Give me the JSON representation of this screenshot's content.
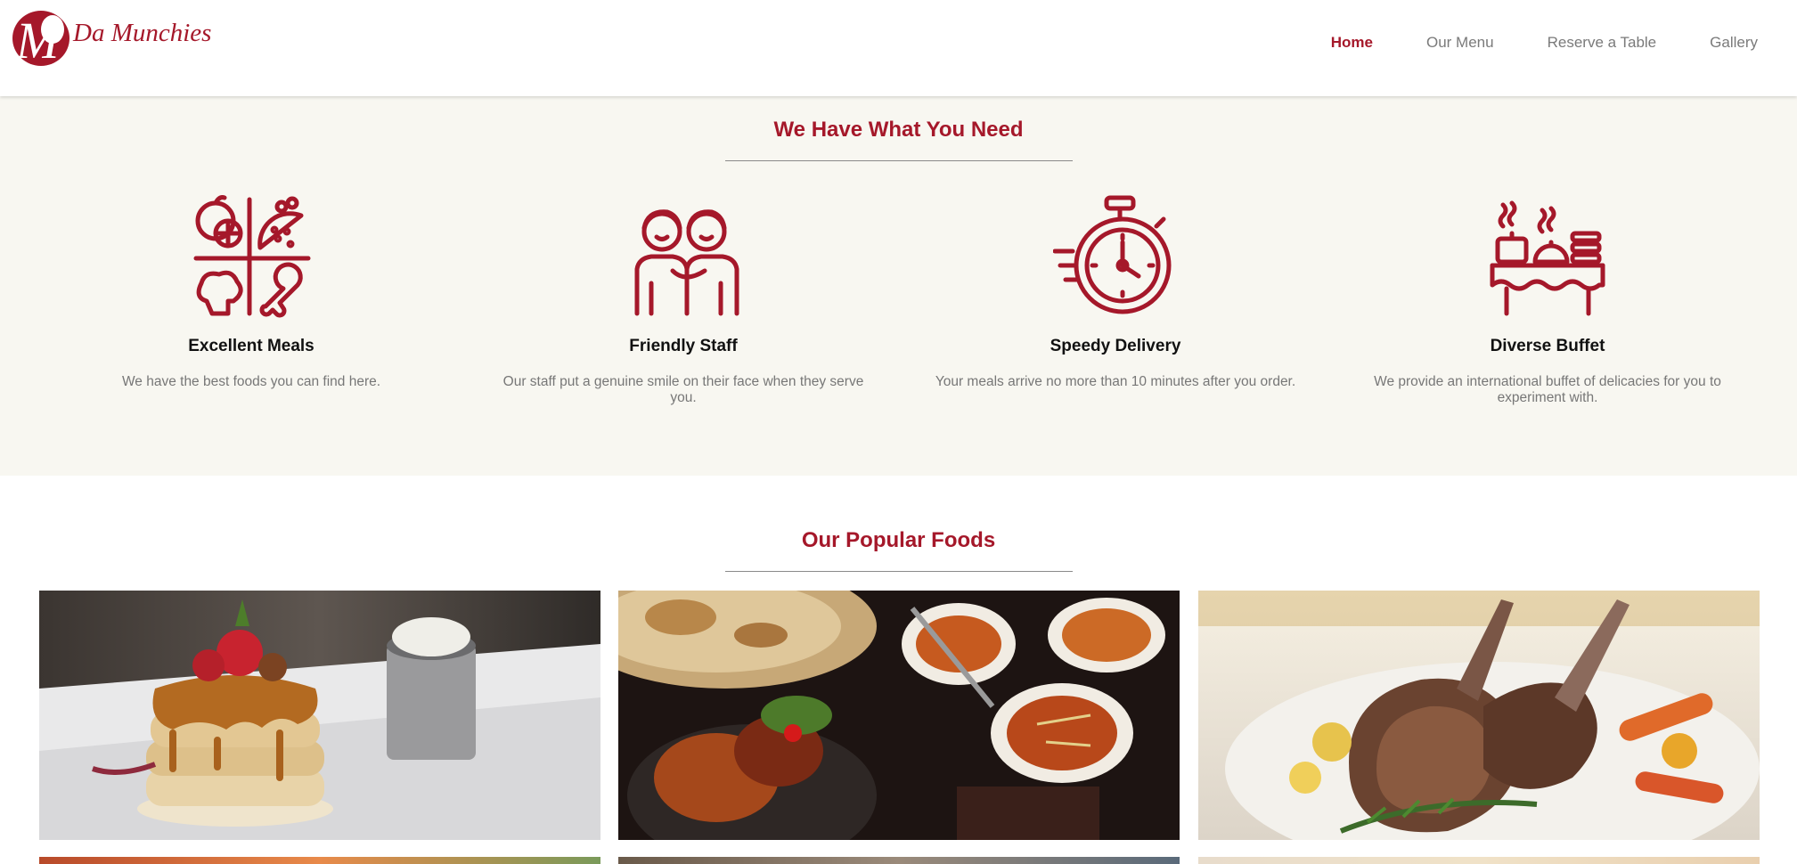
{
  "brand": {
    "logo_letter": "M",
    "name": "Da Munchies",
    "accent": "#a5182a"
  },
  "nav": {
    "items": [
      {
        "label": "Home",
        "active": true
      },
      {
        "label": "Our Menu",
        "active": false
      },
      {
        "label": "Reserve a Table",
        "active": false
      },
      {
        "label": "Gallery",
        "active": false
      }
    ]
  },
  "features": {
    "title": "We Have What You Need",
    "items": [
      {
        "icon": "meals-icon",
        "title": "Excellent Meals",
        "text": "We have the best foods you can find here."
      },
      {
        "icon": "staff-icon",
        "title": "Friendly Staff",
        "text": "Our staff put a genuine smile on their face when they serve you."
      },
      {
        "icon": "stopwatch-icon",
        "title": "Speedy Delivery",
        "text": "Your meals arrive no more than 10 minutes after you order."
      },
      {
        "icon": "buffet-icon",
        "title": "Diverse Buffet",
        "text": "We provide an international buffet of delicacies for you to experiment with."
      }
    ]
  },
  "popular": {
    "title": "Our Popular Foods",
    "photos": [
      "pancakes-photo",
      "curry-naan-photo",
      "lamb-chops-photo"
    ]
  }
}
